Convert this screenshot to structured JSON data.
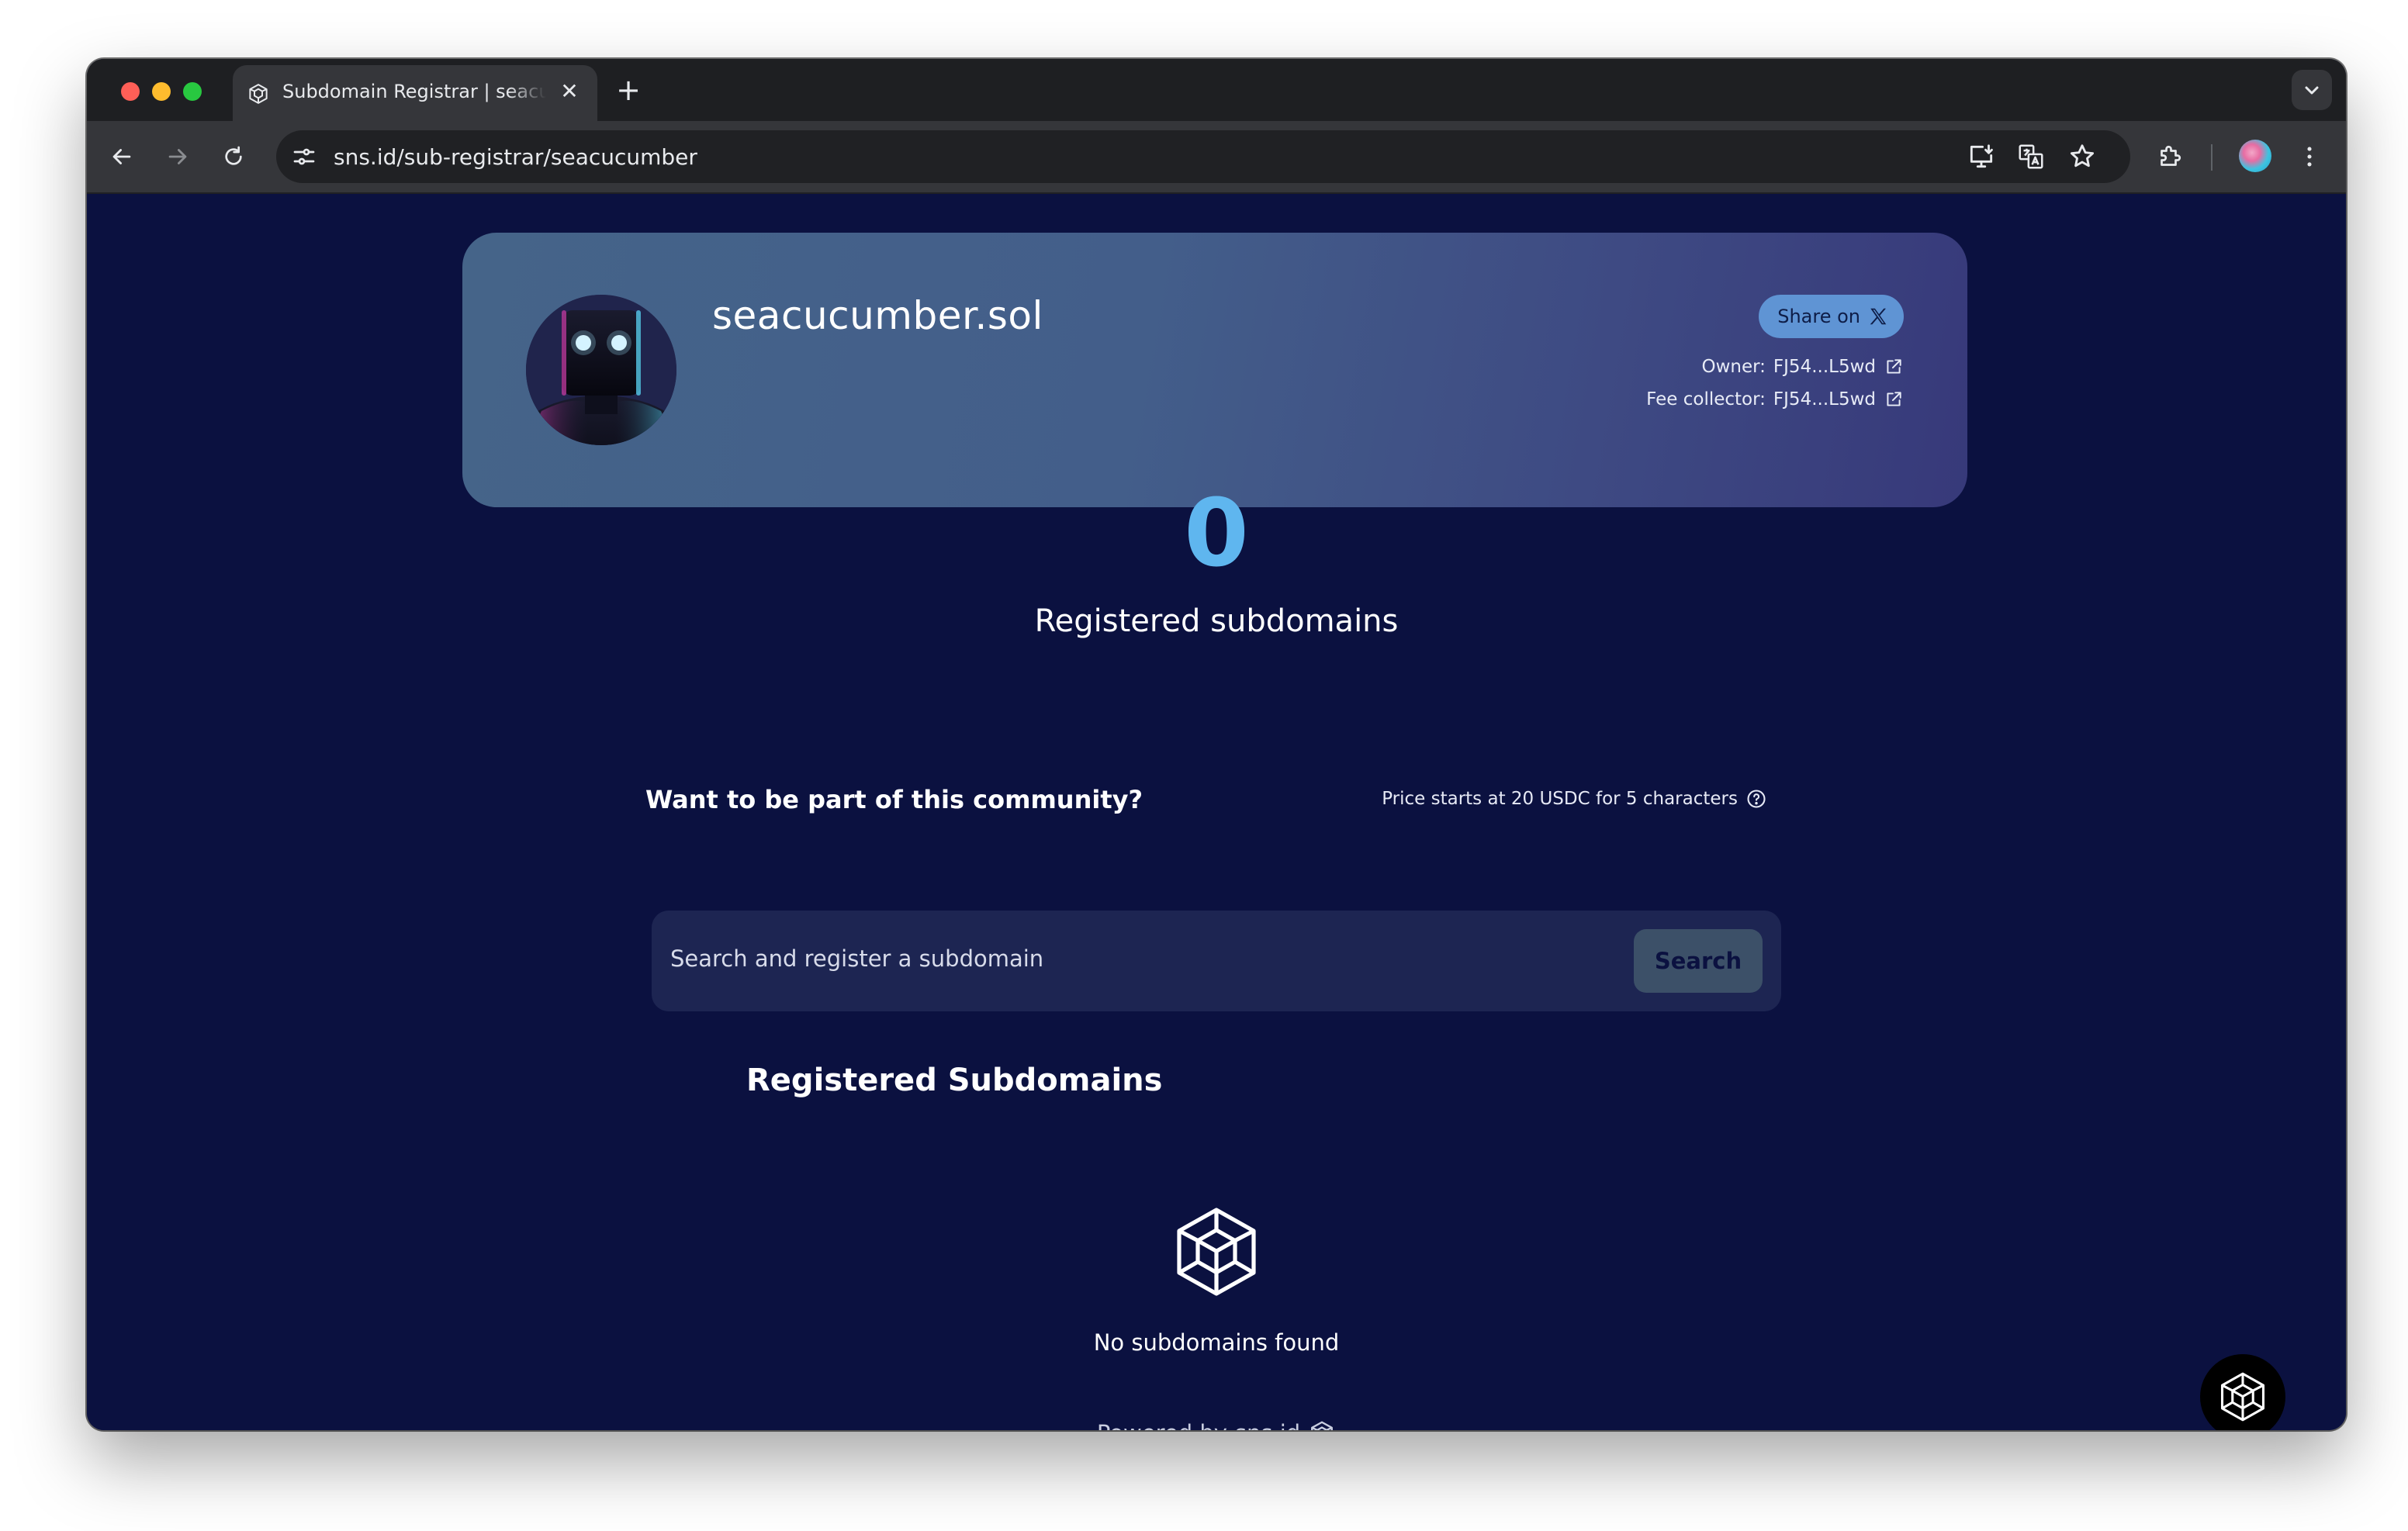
{
  "browser": {
    "tab": {
      "title": "Subdomain Registrar | seacucumber",
      "close_glyph": "✕",
      "icon": "cube-icon"
    },
    "new_tab_glyph": "+",
    "address_bar": {
      "url": "sns.id/sub-registrar/seacucumber"
    },
    "toolbar_icons": [
      "back-icon",
      "forward-icon",
      "reload-icon",
      "site-info-icon",
      "install-app-icon",
      "translate-icon",
      "bookmark-star-icon",
      "extensions-icon",
      "profile-avatar",
      "more-menu-icon"
    ]
  },
  "header": {
    "domain": "seacucumber.sol",
    "share_label": "Share on",
    "owner_label": "Owner:",
    "owner_value": "FJ54...L5wd",
    "fee_label": "Fee collector:",
    "fee_value": "FJ54...L5wd"
  },
  "stats": {
    "count": "0",
    "label": "Registered subdomains"
  },
  "cta": {
    "title": "Want to be part of this community?",
    "price_text": "Price starts at 20 USDC for 5 characters"
  },
  "search": {
    "placeholder": "Search and register a subdomain",
    "button_label": "Search"
  },
  "list": {
    "title": "Registered Subdomains",
    "empty_text": "No subdomains found"
  },
  "footer": {
    "powered_by": "Powered by",
    "link_text": "sns.id"
  },
  "colors": {
    "page_bg": "#0b1140",
    "accent_count": "#5fb6ef",
    "share_button": "#5f94d4",
    "search_button": "#3c5068"
  }
}
